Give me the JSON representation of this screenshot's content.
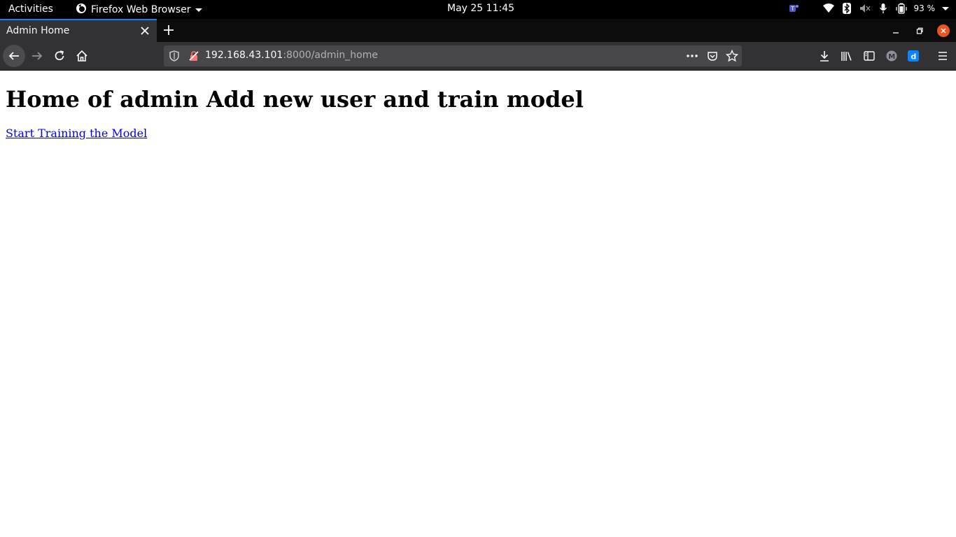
{
  "system_bar": {
    "activities": "Activities",
    "app_name": "Firefox Web Browser",
    "clock": "May 25  11:45",
    "battery": "93 %"
  },
  "browser": {
    "tab_title": "Admin Home",
    "url_host": "192.168.43.101",
    "url_rest": ":8000/admin_home"
  },
  "page": {
    "heading": "Home of admin Add new user and train model",
    "link": "Start Training the Model"
  },
  "colors": {
    "accent": "#0a84ff",
    "link": "#0000ee",
    "close": "#e95420"
  }
}
